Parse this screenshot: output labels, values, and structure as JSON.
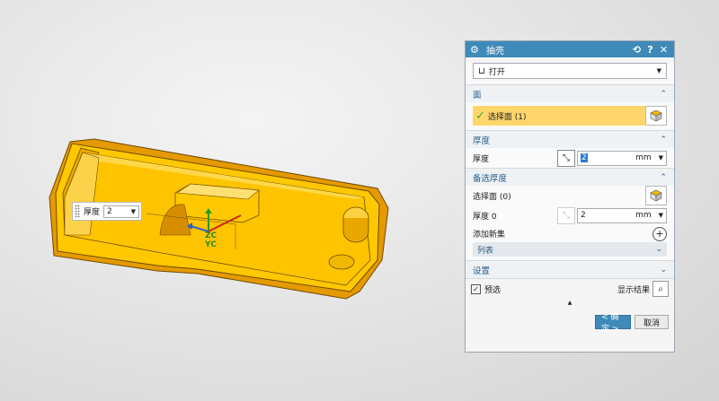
{
  "dialog": {
    "title": "抽壳",
    "icon": "gear-icon",
    "header_buttons": {
      "reset": "⟲",
      "help": "?",
      "close": "✕"
    },
    "type": {
      "value": "打开",
      "icon": "open-shell-icon"
    },
    "face": {
      "header": "面",
      "select_label": "选择面 (1)"
    },
    "thickness": {
      "header": "厚度",
      "label": "厚度",
      "value": "2",
      "unit": "mm"
    },
    "alt_thickness": {
      "header": "备选厚度",
      "select_label": "选择面 (0)",
      "thickness_label": "厚度 0",
      "value": "2",
      "unit": "mm",
      "add_set_label": "添加新集",
      "list_label": "列表"
    },
    "settings": {
      "header": "设置",
      "preview_label": "预选",
      "preview_checked": true,
      "show_result_label": "显示结果"
    },
    "ok_label": "< 确定 >",
    "cancel_label": "取消"
  },
  "viewport": {
    "float_input": {
      "label": "厚度",
      "value": "2"
    },
    "csys": {
      "zc": "ZC",
      "yc": "YC"
    }
  },
  "colors": {
    "titlebar": "#3f8ab8",
    "part": "#f5b800",
    "selection": "#ffd66b"
  }
}
